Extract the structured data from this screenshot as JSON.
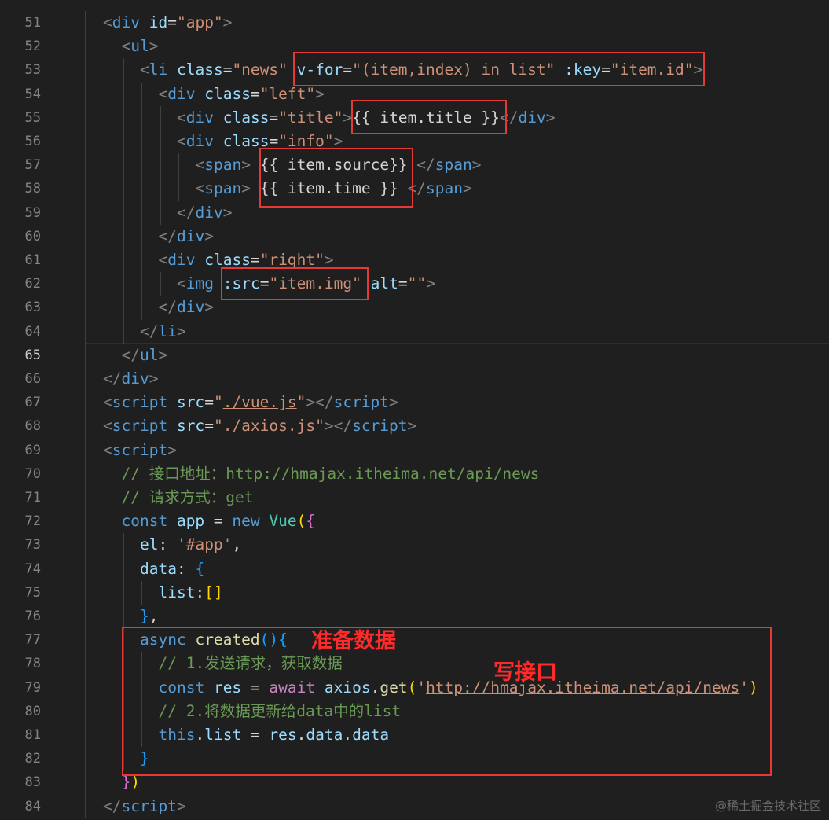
{
  "editor": {
    "active_line": 65,
    "lines": [
      {
        "n": "51",
        "indent": 0,
        "t": [
          [
            "br",
            "<"
          ],
          [
            "tag",
            "div"
          ],
          [
            "txt",
            " "
          ],
          [
            "attr",
            "id"
          ],
          [
            "txt",
            "="
          ],
          [
            "str",
            "\"app\""
          ],
          [
            "br",
            ">"
          ]
        ]
      },
      {
        "n": "52",
        "indent": 1,
        "t": [
          [
            "br",
            "<"
          ],
          [
            "tag",
            "ul"
          ],
          [
            "br",
            ">"
          ]
        ]
      },
      {
        "n": "53",
        "indent": 2,
        "t": [
          [
            "br",
            "<"
          ],
          [
            "tag",
            "li"
          ],
          [
            "txt",
            " "
          ],
          [
            "attr",
            "class"
          ],
          [
            "txt",
            "="
          ],
          [
            "str",
            "\"news\""
          ],
          [
            "txt",
            " "
          ],
          [
            "attr",
            "v-for"
          ],
          [
            "txt",
            "="
          ],
          [
            "str",
            "\"(item,index) in list\""
          ],
          [
            "txt",
            " "
          ],
          [
            "attr",
            ":key"
          ],
          [
            "txt",
            "="
          ],
          [
            "str",
            "\"item.id\""
          ],
          [
            "br",
            ">"
          ]
        ]
      },
      {
        "n": "54",
        "indent": 3,
        "t": [
          [
            "br",
            "<"
          ],
          [
            "tag",
            "div"
          ],
          [
            "txt",
            " "
          ],
          [
            "attr",
            "class"
          ],
          [
            "txt",
            "="
          ],
          [
            "str",
            "\"left\""
          ],
          [
            "br",
            ">"
          ]
        ]
      },
      {
        "n": "55",
        "indent": 4,
        "t": [
          [
            "br",
            "<"
          ],
          [
            "tag",
            "div"
          ],
          [
            "txt",
            " "
          ],
          [
            "attr",
            "class"
          ],
          [
            "txt",
            "="
          ],
          [
            "str",
            "\"title\""
          ],
          [
            "br",
            ">"
          ],
          [
            "txt",
            "{{ item.title }}"
          ],
          [
            "br",
            "</"
          ],
          [
            "tag",
            "div"
          ],
          [
            "br",
            ">"
          ]
        ]
      },
      {
        "n": "56",
        "indent": 4,
        "t": [
          [
            "br",
            "<"
          ],
          [
            "tag",
            "div"
          ],
          [
            "txt",
            " "
          ],
          [
            "attr",
            "class"
          ],
          [
            "txt",
            "="
          ],
          [
            "str",
            "\"info\""
          ],
          [
            "br",
            ">"
          ]
        ]
      },
      {
        "n": "57",
        "indent": 5,
        "t": [
          [
            "br",
            "<"
          ],
          [
            "tag",
            "span"
          ],
          [
            "br",
            ">"
          ],
          [
            "txt",
            " {{ item.source}} "
          ],
          [
            "br",
            "</"
          ],
          [
            "tag",
            "span"
          ],
          [
            "br",
            ">"
          ]
        ]
      },
      {
        "n": "58",
        "indent": 5,
        "t": [
          [
            "br",
            "<"
          ],
          [
            "tag",
            "span"
          ],
          [
            "br",
            ">"
          ],
          [
            "txt",
            " {{ item.time }} "
          ],
          [
            "br",
            "</"
          ],
          [
            "tag",
            "span"
          ],
          [
            "br",
            ">"
          ]
        ]
      },
      {
        "n": "59",
        "indent": 4,
        "t": [
          [
            "br",
            "</"
          ],
          [
            "tag",
            "div"
          ],
          [
            "br",
            ">"
          ]
        ]
      },
      {
        "n": "60",
        "indent": 3,
        "t": [
          [
            "br",
            "</"
          ],
          [
            "tag",
            "div"
          ],
          [
            "br",
            ">"
          ]
        ]
      },
      {
        "n": "61",
        "indent": 3,
        "t": [
          [
            "br",
            "<"
          ],
          [
            "tag",
            "div"
          ],
          [
            "txt",
            " "
          ],
          [
            "attr",
            "class"
          ],
          [
            "txt",
            "="
          ],
          [
            "str",
            "\"right\""
          ],
          [
            "br",
            ">"
          ]
        ]
      },
      {
        "n": "62",
        "indent": 4,
        "t": [
          [
            "br",
            "<"
          ],
          [
            "tag",
            "img"
          ],
          [
            "txt",
            " "
          ],
          [
            "attr",
            ":src"
          ],
          [
            "txt",
            "="
          ],
          [
            "str",
            "\"item.img\""
          ],
          [
            "txt",
            " "
          ],
          [
            "attr",
            "alt"
          ],
          [
            "txt",
            "="
          ],
          [
            "str",
            "\"\""
          ],
          [
            "br",
            ">"
          ]
        ]
      },
      {
        "n": "63",
        "indent": 3,
        "t": [
          [
            "br",
            "</"
          ],
          [
            "tag",
            "div"
          ],
          [
            "br",
            ">"
          ]
        ]
      },
      {
        "n": "64",
        "indent": 2,
        "t": [
          [
            "br",
            "</"
          ],
          [
            "tag",
            "li"
          ],
          [
            "br",
            ">"
          ]
        ]
      },
      {
        "n": "65",
        "indent": 1,
        "t": [
          [
            "br",
            "</"
          ],
          [
            "tag",
            "ul"
          ],
          [
            "br",
            ">"
          ]
        ]
      },
      {
        "n": "66",
        "indent": 0,
        "t": [
          [
            "br",
            "</"
          ],
          [
            "tag",
            "div"
          ],
          [
            "br",
            ">"
          ]
        ]
      },
      {
        "n": "67",
        "indent": 0,
        "t": [
          [
            "br",
            "<"
          ],
          [
            "tag",
            "script"
          ],
          [
            "txt",
            " "
          ],
          [
            "attr",
            "src"
          ],
          [
            "txt",
            "="
          ],
          [
            "str",
            "\""
          ],
          [
            "str pth",
            "./vue.js"
          ],
          [
            "str",
            "\""
          ],
          [
            "br",
            "></"
          ],
          [
            "tag",
            "script"
          ],
          [
            "br",
            ">"
          ]
        ]
      },
      {
        "n": "68",
        "indent": 0,
        "t": [
          [
            "br",
            "<"
          ],
          [
            "tag",
            "script"
          ],
          [
            "txt",
            " "
          ],
          [
            "attr",
            "src"
          ],
          [
            "txt",
            "="
          ],
          [
            "str",
            "\""
          ],
          [
            "str pth",
            "./axios.js"
          ],
          [
            "str",
            "\""
          ],
          [
            "br",
            "></"
          ],
          [
            "tag",
            "script"
          ],
          [
            "br",
            ">"
          ]
        ]
      },
      {
        "n": "69",
        "indent": 0,
        "t": [
          [
            "br",
            "<"
          ],
          [
            "tag",
            "script"
          ],
          [
            "br",
            ">"
          ]
        ]
      },
      {
        "n": "70",
        "indent": 1,
        "t": [
          [
            "cmt",
            "// 接口地址："
          ],
          [
            "cmt url",
            "http://hmajax.itheima.net/api/news"
          ]
        ]
      },
      {
        "n": "71",
        "indent": 1,
        "t": [
          [
            "cmt",
            "// 请求方式：get"
          ]
        ]
      },
      {
        "n": "72",
        "indent": 1,
        "t": [
          [
            "kw",
            "const"
          ],
          [
            "txt",
            " "
          ],
          [
            "var",
            "app"
          ],
          [
            "txt",
            " = "
          ],
          [
            "kw",
            "new"
          ],
          [
            "txt",
            " "
          ],
          [
            "cls",
            "Vue"
          ],
          [
            "b1",
            "("
          ],
          [
            "b2",
            "{"
          ]
        ]
      },
      {
        "n": "73",
        "indent": 2,
        "t": [
          [
            "var",
            "el"
          ],
          [
            "txt",
            ": "
          ],
          [
            "str",
            "'#app'"
          ],
          [
            "txt",
            ","
          ]
        ]
      },
      {
        "n": "74",
        "indent": 2,
        "t": [
          [
            "var",
            "data"
          ],
          [
            "txt",
            ": "
          ],
          [
            "b3",
            "{"
          ]
        ]
      },
      {
        "n": "75",
        "indent": 3,
        "t": [
          [
            "var",
            "list"
          ],
          [
            "txt",
            ":"
          ],
          [
            "b1",
            "[]"
          ]
        ]
      },
      {
        "n": "76",
        "indent": 2,
        "t": [
          [
            "b3",
            "}"
          ],
          [
            "txt",
            ","
          ]
        ]
      },
      {
        "n": "77",
        "indent": 2,
        "t": [
          [
            "kw",
            "async"
          ],
          [
            "txt",
            " "
          ],
          [
            "fn",
            "created"
          ],
          [
            "b3",
            "()"
          ],
          [
            "b3",
            "{"
          ]
        ]
      },
      {
        "n": "78",
        "indent": 3,
        "t": [
          [
            "cmt",
            "// 1.发送请求，获取数据"
          ]
        ]
      },
      {
        "n": "79",
        "indent": 3,
        "t": [
          [
            "kw",
            "const"
          ],
          [
            "txt",
            " "
          ],
          [
            "var",
            "res"
          ],
          [
            "txt",
            " = "
          ],
          [
            "ctl",
            "await"
          ],
          [
            "txt",
            " "
          ],
          [
            "var",
            "axios"
          ],
          [
            "txt",
            "."
          ],
          [
            "fn",
            "get"
          ],
          [
            "b1",
            "("
          ],
          [
            "str",
            "'"
          ],
          [
            "str pth",
            "http://hmajax.itheima.net/api/news"
          ],
          [
            "str",
            "'"
          ],
          [
            "b1",
            ")"
          ]
        ]
      },
      {
        "n": "80",
        "indent": 3,
        "t": [
          [
            "cmt",
            "// 2.将数据更新给data中的list"
          ]
        ]
      },
      {
        "n": "81",
        "indent": 3,
        "t": [
          [
            "kw",
            "this"
          ],
          [
            "txt",
            "."
          ],
          [
            "var",
            "list"
          ],
          [
            "txt",
            " = "
          ],
          [
            "var",
            "res"
          ],
          [
            "txt",
            "."
          ],
          [
            "var",
            "data"
          ],
          [
            "txt",
            "."
          ],
          [
            "var",
            "data"
          ]
        ]
      },
      {
        "n": "82",
        "indent": 2,
        "t": [
          [
            "b3",
            "}"
          ]
        ]
      },
      {
        "n": "83",
        "indent": 1,
        "t": [
          [
            "b2",
            "}"
          ],
          [
            "b1",
            ")"
          ]
        ]
      },
      {
        "n": "84",
        "indent": 0,
        "t": [
          [
            "br",
            "</"
          ],
          [
            "tag",
            "script"
          ],
          [
            "br",
            ">"
          ]
        ]
      }
    ]
  },
  "annotations": {
    "note_prepare": "准备数据",
    "note_api": "写接口"
  },
  "watermark": "@稀土掘金技术社区"
}
